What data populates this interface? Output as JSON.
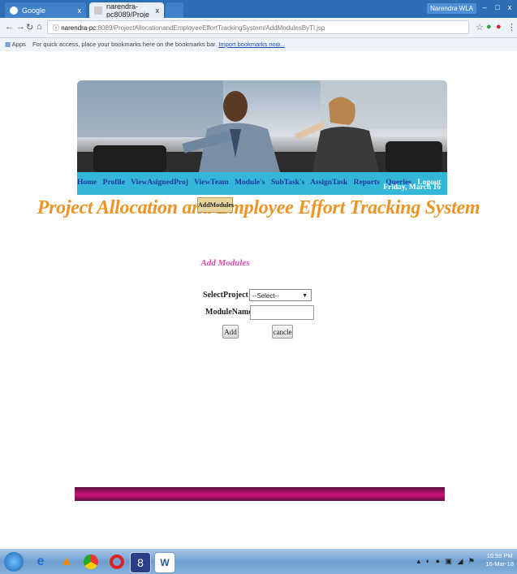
{
  "browser": {
    "tab1_title": "Google",
    "tab2_title": "narendra-pc8089/Proje",
    "tab_close": "x",
    "user_badge": "Narendra WLA",
    "window_controls": [
      "–",
      "□",
      "x"
    ],
    "url_host": "narendra-pc",
    "url_path": ":8089/ProjectAllocationandEmployeeEffortTrackingSystem/AddModulesByTl.jsp",
    "bookmarks_apps": "Apps",
    "bookmarks_hint": "For quick access, place your bookmarks here on the bookmarks bar.",
    "bookmarks_import": "Import bookmarks now..."
  },
  "nav": {
    "items": [
      "Home",
      "Profile",
      "ViewAsignedProj",
      "ViewTeam",
      "Module's",
      "SubTask's",
      "AssignTask",
      "Reports",
      "Queries"
    ],
    "logout": "Logout",
    "date": "Friday, March 16",
    "tooltip": "AddModules"
  },
  "page": {
    "app_title": "Project Allocation and Employee Effort Tracking System",
    "form_title": "Add Modules"
  },
  "form": {
    "select_project_label": "SelectProject",
    "select_project_value": "--Select--",
    "module_name_label": "ModuleName",
    "module_name_value": "",
    "add_button": "Add",
    "cancel_button": "cancle"
  },
  "taskbar": {
    "time": "10:59 PM",
    "date": "16-Mar-18"
  },
  "colors": {
    "nav_bg": "#34b6d9",
    "nav_link": "#1e3a9e",
    "title_orange": "#ee9424",
    "form_title_pink": "#d94bb2",
    "footer_magenta": "#d0137b"
  }
}
